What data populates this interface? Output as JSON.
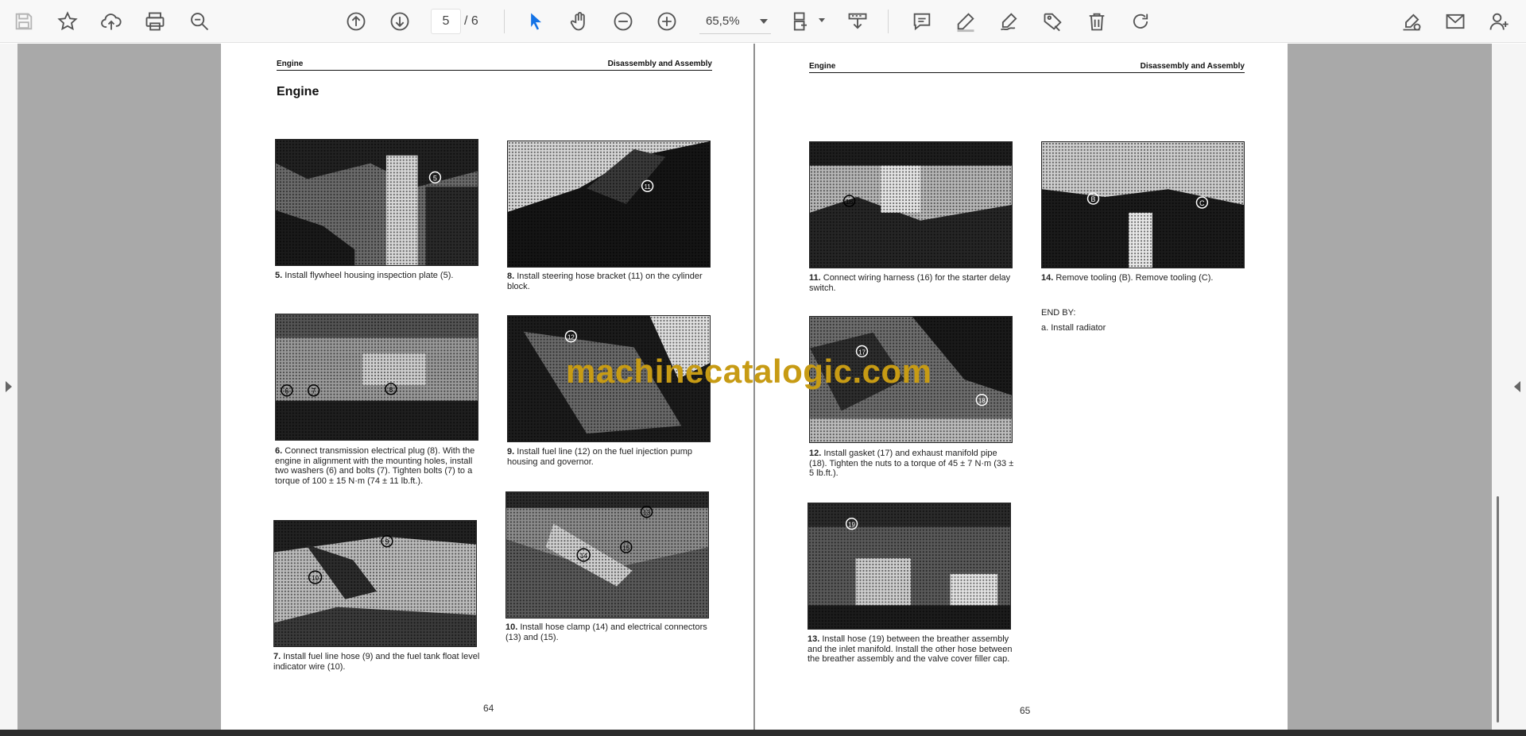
{
  "toolbar": {
    "page_current": "5",
    "page_total": "/ 6",
    "zoom": "65,5%"
  },
  "left_page": {
    "header_left": "Engine",
    "header_right": "Disassembly and Assembly",
    "section_title": "Engine",
    "page_number": "64",
    "steps": [
      {
        "num": "5.",
        "text": "Install flywheel housing inspection plate (5)."
      },
      {
        "num": "8.",
        "text": "Install steering hose bracket (11) on the cylinder block."
      },
      {
        "num": "6.",
        "text": "Connect transmission electrical plug (8). With the engine in alignment with the mounting holes, install two washers (6) and bolts (7). Tighten bolts (7) to a torque of 100 ± 15 N·m (74 ± 11 lb.ft.)."
      },
      {
        "num": "9.",
        "text": "Install fuel line (12) on the fuel injection pump housing and governor."
      },
      {
        "num": "7.",
        "text": "Install fuel line hose (9) and the fuel tank float level indicator wire (10)."
      },
      {
        "num": "10.",
        "text": "Install hose clamp (14) and electrical connectors (13) and (15)."
      }
    ]
  },
  "right_page": {
    "header_left": "Engine",
    "header_right": "Disassembly and Assembly",
    "page_number": "65",
    "steps": [
      {
        "num": "11.",
        "text": "Connect wiring harness (16) for the starter delay switch."
      },
      {
        "num": "14.",
        "text": "Remove tooling (B). Remove tooling (C)."
      },
      {
        "num": "12.",
        "text": "Install gasket (17) and exhaust manifold pipe (18). Tighten the nuts to a torque of 45 ± 7 N·m (33 ± 5 lb.ft.)."
      },
      {
        "num": "13.",
        "text": "Install hose (19) between the breather assembly and the inlet manifold. Install the other hose between the breather assembly and the valve cover filler cap."
      }
    ],
    "end_by_label": "END BY:",
    "end_by_item": "a. Install radiator"
  },
  "watermark": "machinecatalogic.com",
  "photo_callouts": {
    "p5": "5",
    "p8": "11",
    "p6": [
      "6",
      "7",
      "8"
    ],
    "p9": "12",
    "p7": [
      "9",
      "10"
    ],
    "p10": [
      "13",
      "14",
      "15"
    ],
    "p11": "16",
    "p14": [
      "B",
      "C"
    ],
    "p12": [
      "17",
      "18"
    ],
    "p13": "19"
  },
  "colors": {
    "accent": "#1473e6",
    "watermark": "#c79b14",
    "viewer_bg": "#a9a9a9"
  },
  "icons": {
    "toolbar": [
      "save-icon",
      "bookmark-star-icon",
      "cloud-upload-icon",
      "print-icon",
      "zoom-search-icon",
      "page-up-icon",
      "page-down-icon",
      "select-pointer-icon",
      "hand-pan-icon",
      "zoom-out-icon",
      "zoom-in-icon",
      "crop-icon",
      "extract-icon",
      "comment-icon",
      "highlight-pen-icon",
      "draw-icon",
      "stamp-icon",
      "delete-icon",
      "rotate-icon",
      "sign-icon",
      "mail-icon",
      "add-user-icon"
    ]
  }
}
